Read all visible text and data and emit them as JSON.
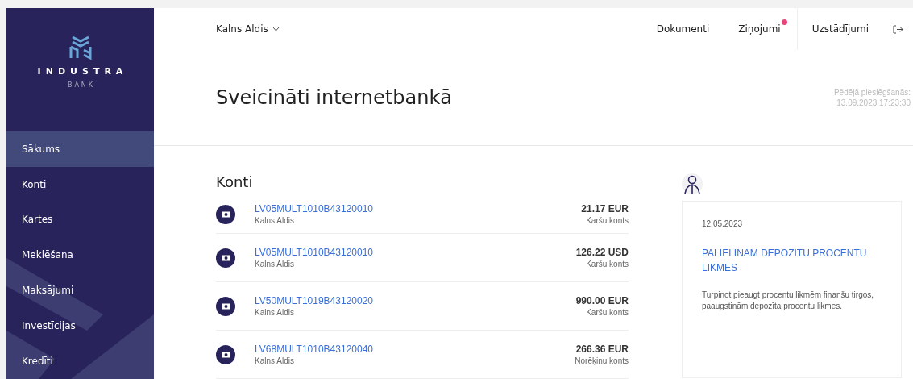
{
  "brand": {
    "name": "INDUSTRA",
    "subtitle": "BANK"
  },
  "sidebar": {
    "items": [
      {
        "label": "Sākums",
        "selected": true
      },
      {
        "label": "Konti",
        "selected": false
      },
      {
        "label": "Kartes",
        "selected": false
      },
      {
        "label": "Meklēšana",
        "selected": false
      },
      {
        "label": "Maksājumi",
        "selected": false
      },
      {
        "label": "Investīcijas",
        "selected": false
      },
      {
        "label": "Kredīti",
        "selected": false
      }
    ]
  },
  "header": {
    "user": "Kalns Aldis",
    "links": [
      {
        "label": "Dokumenti",
        "unread": false
      },
      {
        "label": "Ziņojumi",
        "unread": true
      },
      {
        "label": "Uzstādījumi",
        "unread": false
      }
    ]
  },
  "title": "Sveicināti internetbankā",
  "last_login": {
    "label": "Pēdējā pieslēgšanās:",
    "value": "13.09.2023 17:23:30"
  },
  "accounts": {
    "heading": "Konti",
    "rows": [
      {
        "iban": "LV05MULT1010B43120010",
        "owner": "Kalns Aldis",
        "amount": "21.17 EUR",
        "type": "Karšu konts"
      },
      {
        "iban": "LV05MULT1010B43120010",
        "owner": "Kalns Aldis",
        "amount": "126.22 USD",
        "type": "Karšu konts"
      },
      {
        "iban": "LV50MULT1019B43120020",
        "owner": "Kalns Aldis",
        "amount": "990.00 EUR",
        "type": "Karšu konts"
      },
      {
        "iban": "LV68MULT1010B43120040",
        "owner": "Kalns Aldis",
        "amount": "266.36 EUR",
        "type": "Norēķinu konts"
      }
    ]
  },
  "news": {
    "date": "12.05.2023",
    "headline": "PALIELINĀM DEPOZĪTU PROCENTU LIKMES",
    "body": "Turpinot pieaugt procentu likmēm finanšu tirgos, paaugstinām depozīta  procentu likmes."
  }
}
